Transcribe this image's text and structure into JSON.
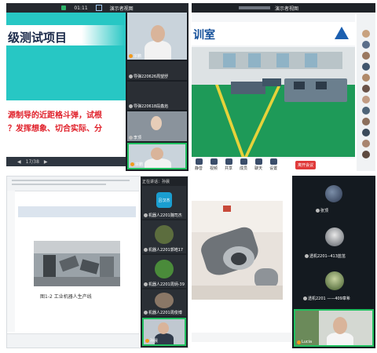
{
  "q1": {
    "menu_label": "演示者视图",
    "time": "01:11",
    "slide_title": "级测试项目",
    "slide_text_line1": "源制导的近距格斗弹，试根",
    "slide_text_line2": "？发挥想象、切合实际、分",
    "slide_counter": "17/38",
    "participants": [
      {
        "name": "宗鹏"
      },
      {
        "name": "导弹220626周望舒"
      },
      {
        "name": "导弹220618段鑫焰"
      },
      {
        "name": "李顶"
      },
      {
        "name": "宗鹏"
      }
    ]
  },
  "q2": {
    "menu_label": "演示者视图",
    "room_title": "训室",
    "end_button": "离开会议",
    "toolbar": [
      "静音",
      "视频",
      "共享",
      "成员",
      "聊天",
      "设置"
    ],
    "participant_count": 12
  },
  "q3": {
    "top_label": "正在讲话：孙晨",
    "figure_caption": "图1-2  工业机器人生产线",
    "participants": [
      {
        "name": "机器人2201魏司杰"
      },
      {
        "name": "机器人2201郭皓17"
      },
      {
        "name": "机器人2201周炳-39"
      },
      {
        "name": "机器人2201周俊博"
      },
      {
        "name": "孙晨"
      }
    ],
    "avatar_text": "吕汉杰"
  },
  "q4": {
    "participants": [
      {
        "name": "张顶"
      },
      {
        "name": "透机2201--413蓝茁"
      },
      {
        "name": "透机2201 ——409章希"
      },
      {
        "name": "Lucia"
      }
    ]
  },
  "colors": {
    "teal": "#27c7c4",
    "red_text": "#e0202a",
    "factory_floor": "#1f9c5a",
    "speaking_border": "#20c060",
    "dark": "#101418"
  }
}
